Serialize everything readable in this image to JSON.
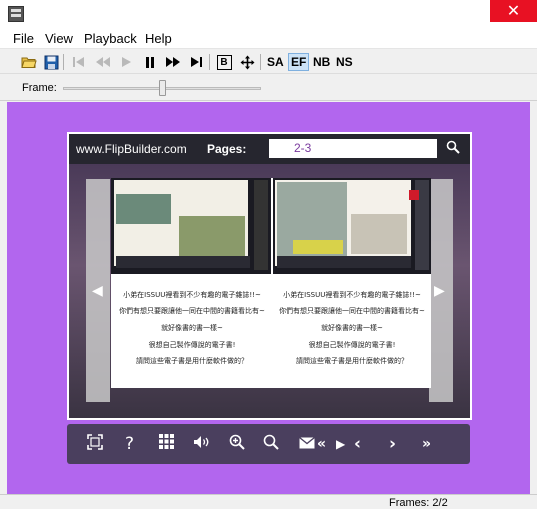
{
  "window": {
    "close_label": "✕"
  },
  "menu": {
    "file": "File",
    "view": "View",
    "playback": "Playback",
    "help": "Help"
  },
  "toolbar": {
    "b_label": "B",
    "sa_label": "SA",
    "ef_label": "EF",
    "nb_label": "NB",
    "ns_label": "NS"
  },
  "frame": {
    "label": "Frame:",
    "position": 0.5
  },
  "viewer": {
    "logo": "www.FlipBuilder.com",
    "pages_label": "Pages:",
    "pages_value": "2-3",
    "left_page_lines": [
      "小弟在ISSUU裡看到不少有趣的電子雜誌!!~",
      "你們有想只要跟讓他一同在中間的書籍看比有~",
      "就好像書的書一樣~",
      "很想自己製作傳說的電子書!",
      "請問這些電子書是用什麼軟件做的？"
    ],
    "right_page_lines": [
      "小弟在ISSUU裡看到不少有趣的電子雜誌!!~",
      "你們有想只要跟讓他一同在中間的書籍看比有~",
      "就好像書的書一樣~",
      "很想自己製作傳說的電子書!",
      "請問這些電子書是用什麼軟件做的？"
    ]
  },
  "status": {
    "frames": "Frames: 2/2"
  },
  "colors": {
    "viewer_bg": "#b266ee",
    "close_bg": "#e81123",
    "control_bar": "#4a3f5e"
  }
}
